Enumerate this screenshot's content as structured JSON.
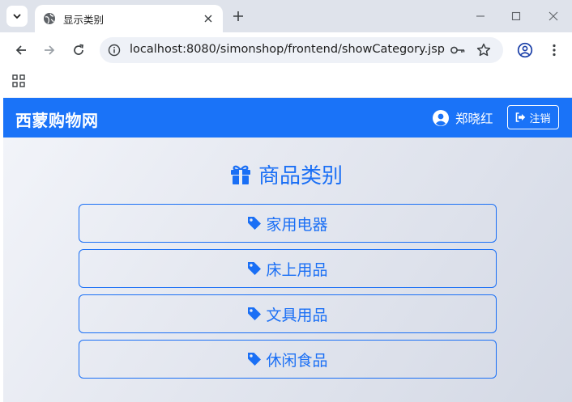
{
  "browser": {
    "tab_title": "显示类别",
    "url": "localhost:8080/simonshop/frontend/showCategory.jsp"
  },
  "site": {
    "brand": "西蒙购物网",
    "user_name": "郑晓红",
    "logout_label": "注销",
    "heading": "商品类别",
    "accent_color": "#1a73f8"
  },
  "categories": [
    {
      "label": "家用电器"
    },
    {
      "label": "床上用品"
    },
    {
      "label": "文具用品"
    },
    {
      "label": "休闲食品"
    }
  ]
}
